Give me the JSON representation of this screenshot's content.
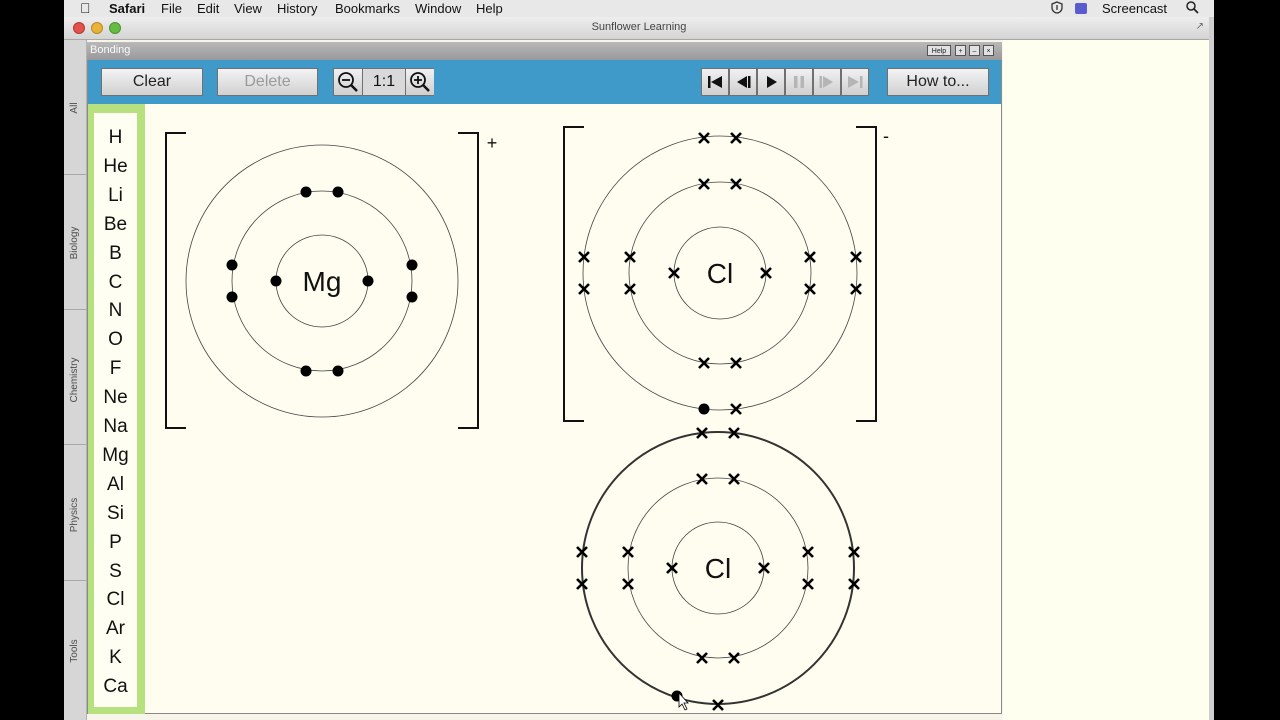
{
  "menubar": {
    "apple": "",
    "app": "Safari",
    "items": [
      "File",
      "Edit",
      "View",
      "History",
      "Bookmarks",
      "Window",
      "Help"
    ],
    "right_app": "Screencast"
  },
  "window": {
    "title": "Sunflower Learning"
  },
  "side_tabs": [
    "All",
    "Biology",
    "Chemistry",
    "Physics",
    "Tools"
  ],
  "app": {
    "title": "Bonding",
    "help_label": "Help",
    "toolbar": {
      "clear_label": "Clear",
      "delete_label": "Delete",
      "zoom_level": "1:1",
      "howto_label": "How to..."
    },
    "elements": [
      "H",
      "He",
      "Li",
      "Be",
      "B",
      "C",
      "N",
      "O",
      "F",
      "Ne",
      "Na",
      "Mg",
      "Al",
      "Si",
      "P",
      "S",
      "Cl",
      "Ar",
      "K",
      "Ca"
    ]
  },
  "diagram": {
    "atoms": [
      {
        "symbol": "Mg",
        "charge": "+",
        "electron_marker": "dot",
        "shells": [
          2,
          8,
          0
        ]
      },
      {
        "symbol": "Cl",
        "charge": "-",
        "electron_marker": "cross",
        "shells": [
          2,
          8,
          8
        ]
      },
      {
        "symbol": "Cl",
        "charge": "",
        "electron_marker": "cross",
        "shells": [
          2,
          8,
          7
        ]
      }
    ]
  },
  "colors": {
    "toolbar": "#3f9ac9",
    "palette": "#b7e07e",
    "canvas": "#fffdf0"
  }
}
